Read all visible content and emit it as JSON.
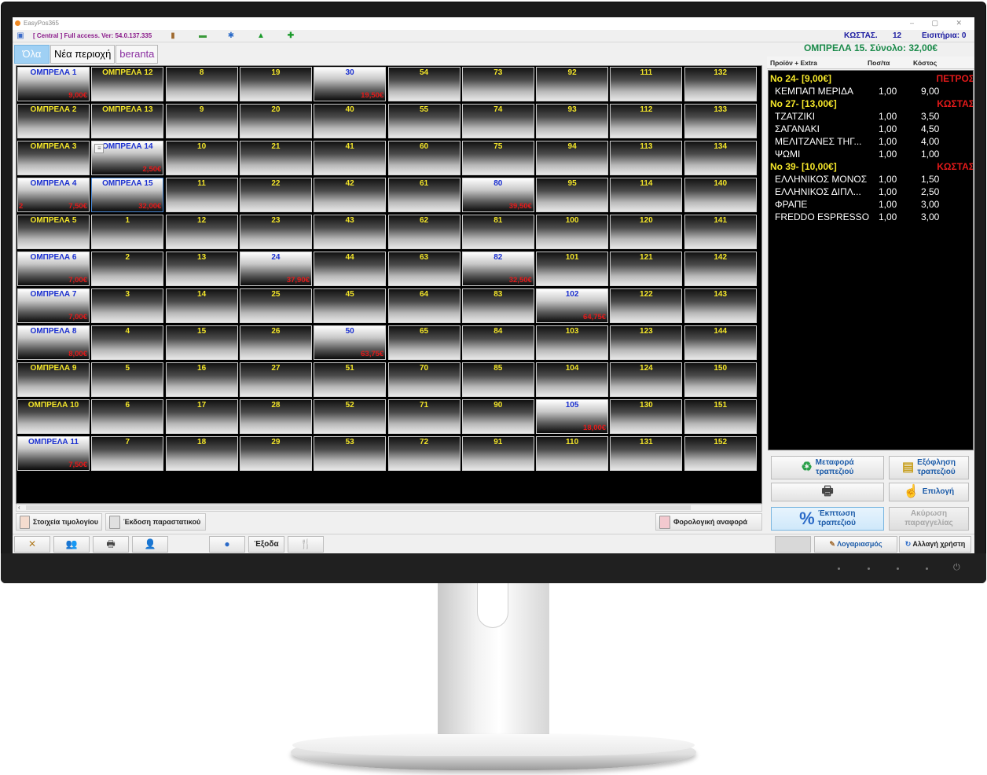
{
  "window": {
    "title": "EasyPos365",
    "controls": "–  ▢  ✕"
  },
  "toolbar": {
    "access_text": "[ Central ] Full access. Ver: 54.0.137.335",
    "cashier_label": "ΚΩΣΤΑΣ.",
    "cashier_number": "12",
    "tickets": "Εισιτήρια: 0"
  },
  "tabs": [
    "Όλα",
    "Νέα περιοχή",
    "beranta"
  ],
  "tables": {
    "columns": [
      [
        {
          "name": "ΟΜΠΡΕΛΑ 1",
          "amount": "9,00€",
          "busy": true
        },
        {
          "name": "ΟΜΠΡΕΛΑ 2"
        },
        {
          "name": "ΟΜΠΡΕΛΑ 3"
        },
        {
          "name": "ΟΜΠΡΕΛΑ 4",
          "amount": "7,50€",
          "busy": true,
          "left_mark": "2"
        },
        {
          "name": "ΟΜΠΡΕΛΑ 5"
        },
        {
          "name": "ΟΜΠΡΕΛΑ 6",
          "amount": "7,00€",
          "busy": true
        },
        {
          "name": "ΟΜΠΡΕΛΑ 7",
          "amount": "7,00€",
          "busy": true
        },
        {
          "name": "ΟΜΠΡΕΛΑ 8",
          "amount": "8,00€",
          "busy": true
        },
        {
          "name": "ΟΜΠΡΕΛΑ 9"
        },
        {
          "name": "ΟΜΠΡΕΛΑ 10"
        },
        {
          "name": "ΟΜΠΡΕΛΑ 11",
          "amount": "7,50€",
          "busy": true
        }
      ],
      [
        {
          "name": "ΟΜΠΡΕΛΑ 12"
        },
        {
          "name": "ΟΜΠΡΕΛΑ 13"
        },
        {
          "name": "ΟΜΠΡΕΛΑ 14",
          "amount": "2,50€",
          "busy": true,
          "note": true
        },
        {
          "name": "ΟΜΠΡΕΛΑ 15",
          "amount": "32,00€",
          "busy": true,
          "selected": true
        },
        {
          "name": "1"
        },
        {
          "name": "2"
        },
        {
          "name": "3"
        },
        {
          "name": "4"
        },
        {
          "name": "5"
        },
        {
          "name": "6"
        },
        {
          "name": "7"
        }
      ],
      [
        {
          "name": "8"
        },
        {
          "name": "9"
        },
        {
          "name": "10"
        },
        {
          "name": "11"
        },
        {
          "name": "12"
        },
        {
          "name": "13"
        },
        {
          "name": "14"
        },
        {
          "name": "15"
        },
        {
          "name": "16"
        },
        {
          "name": "17"
        },
        {
          "name": "18"
        }
      ],
      [
        {
          "name": "19"
        },
        {
          "name": "20"
        },
        {
          "name": "21"
        },
        {
          "name": "22"
        },
        {
          "name": "23"
        },
        {
          "name": "24",
          "amount": "37,90€",
          "busy": true
        },
        {
          "name": "25"
        },
        {
          "name": "26"
        },
        {
          "name": "27"
        },
        {
          "name": "28"
        },
        {
          "name": "29"
        }
      ],
      [
        {
          "name": "30",
          "amount": "19,50€",
          "busy": true
        },
        {
          "name": "40"
        },
        {
          "name": "41"
        },
        {
          "name": "42"
        },
        {
          "name": "43"
        },
        {
          "name": "44"
        },
        {
          "name": "45"
        },
        {
          "name": "50",
          "amount": "63,75€",
          "busy": true
        },
        {
          "name": "51"
        },
        {
          "name": "52"
        },
        {
          "name": "53"
        }
      ],
      [
        {
          "name": "54"
        },
        {
          "name": "55"
        },
        {
          "name": "60"
        },
        {
          "name": "61"
        },
        {
          "name": "62"
        },
        {
          "name": "63"
        },
        {
          "name": "64"
        },
        {
          "name": "65"
        },
        {
          "name": "70"
        },
        {
          "name": "71"
        },
        {
          "name": "72"
        }
      ],
      [
        {
          "name": "73"
        },
        {
          "name": "74"
        },
        {
          "name": "75"
        },
        {
          "name": "80",
          "amount": "39,50€",
          "busy": true
        },
        {
          "name": "81"
        },
        {
          "name": "82",
          "amount": "32,50€",
          "busy": true
        },
        {
          "name": "83"
        },
        {
          "name": "84"
        },
        {
          "name": "85"
        },
        {
          "name": "90"
        },
        {
          "name": "91"
        }
      ],
      [
        {
          "name": "92"
        },
        {
          "name": "93"
        },
        {
          "name": "94"
        },
        {
          "name": "95"
        },
        {
          "name": "100"
        },
        {
          "name": "101"
        },
        {
          "name": "102",
          "amount": "64,75€",
          "busy": true
        },
        {
          "name": "103"
        },
        {
          "name": "104"
        },
        {
          "name": "105",
          "amount": "18,00€",
          "busy": true
        },
        {
          "name": "110"
        }
      ],
      [
        {
          "name": "111"
        },
        {
          "name": "112"
        },
        {
          "name": "113"
        },
        {
          "name": "114"
        },
        {
          "name": "120"
        },
        {
          "name": "121"
        },
        {
          "name": "122"
        },
        {
          "name": "123"
        },
        {
          "name": "124"
        },
        {
          "name": "130"
        },
        {
          "name": "131"
        }
      ],
      [
        {
          "name": "132"
        },
        {
          "name": "133"
        },
        {
          "name": "134"
        },
        {
          "name": "140"
        },
        {
          "name": "141"
        },
        {
          "name": "142"
        },
        {
          "name": "143"
        },
        {
          "name": "144"
        },
        {
          "name": "150"
        },
        {
          "name": "151"
        },
        {
          "name": "152"
        }
      ]
    ]
  },
  "bottom_bar": {
    "invoice_details": "Στοιχεία τιμολογίου",
    "issue_document": "Έκδοση παραστατικού",
    "fiscal_report": "Φορολογική αναφορά",
    "exit": "Έξοδα",
    "accounts": "Λογαριασμός",
    "change_user": "Αλλαγή χρήστη"
  },
  "order_panel": {
    "title": "ΟΜΠΡΕΛΑ 15. Σύνολο: 32,00€",
    "headers": {
      "product": "Προϊόν + Extra",
      "qty": "Ποσ/τα",
      "cost": "Κόστος"
    },
    "groups": [
      {
        "label": "No 24- [9,00€]",
        "waiter": "ΠΕΤΡΟΣ",
        "items": [
          {
            "name": "ΚΕΜΠΑΠ ΜΕΡΙΔΑ",
            "qty": "1,00",
            "cost": "9,00"
          }
        ]
      },
      {
        "label": "No 27- [13,00€]",
        "waiter": "ΚΩΣΤΑΣ",
        "items": [
          {
            "name": "ΤΖΑΤΖΙΚΙ",
            "qty": "1,00",
            "cost": "3,50"
          },
          {
            "name": "ΣΑΓΑΝΑΚΙ",
            "qty": "1,00",
            "cost": "4,50"
          },
          {
            "name": "ΜΕΛΙΤΖΑΝΕΣ ΤΗΓ...",
            "qty": "1,00",
            "cost": "4,00"
          },
          {
            "name": "ΨΩΜΙ",
            "qty": "1,00",
            "cost": "1,00"
          }
        ]
      },
      {
        "label": "No 39- [10,00€]",
        "waiter": "ΚΩΣΤΑΣ",
        "items": [
          {
            "name": "ΕΛΛΗΝΙΚΟΣ ΜΟΝΟΣ",
            "qty": "1,00",
            "cost": "1,50"
          },
          {
            "name": "ΕΛΛΗΝΙΚΟΣ ΔΙΠΛ...",
            "qty": "1,00",
            "cost": "2,50"
          },
          {
            "name": "ΦΡΑΠΕ",
            "qty": "1,00",
            "cost": "3,00"
          },
          {
            "name": "FREDDO ESPRESSO",
            "qty": "1,00",
            "cost": "3,00"
          }
        ]
      }
    ],
    "buttons": {
      "transfer": [
        "Μεταφορά",
        "τραπεζιού"
      ],
      "settle": [
        "Εξόφληση",
        "τραπεζιού"
      ],
      "choose": "Επιλογή",
      "discount": [
        "Έκπτωση",
        "τραπεζιού"
      ],
      "cancel": [
        "Ακύρωση",
        "παραγγελίας"
      ]
    }
  },
  "colors": {
    "table_name": "#f4e62a",
    "busy_name": "#1a2fd0",
    "amount": "#e41a1a",
    "title_green": "#1a8a4a"
  }
}
